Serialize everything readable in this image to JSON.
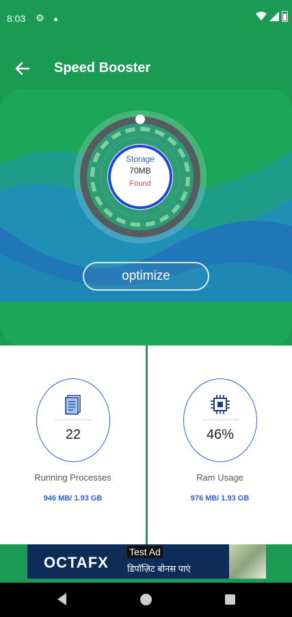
{
  "status_bar": {
    "time": "8:03"
  },
  "app_bar": {
    "title": "Speed Booster"
  },
  "gauge": {
    "storage_label": "Storage",
    "storage_value": "70MB",
    "found_label": "Found"
  },
  "optimize": {
    "label": "optimize"
  },
  "cards": [
    {
      "value": "22",
      "label": "Running Processes",
      "sub": "946 MB/ 1.93 GB",
      "icon": "document-icon"
    },
    {
      "value": "46%",
      "label": "Ram Usage",
      "sub": "976 MB/ 1.93 GB",
      "icon": "chip-icon"
    }
  ],
  "ad": {
    "tag": "Test Ad",
    "brand_a": "OCTA",
    "brand_b": "FX",
    "text": "डिपॉज़िट बोनस पाएं"
  },
  "colors": {
    "primary": "#1a9a52",
    "accent_blue": "#2b5fd6",
    "found_red": "#e53935"
  }
}
